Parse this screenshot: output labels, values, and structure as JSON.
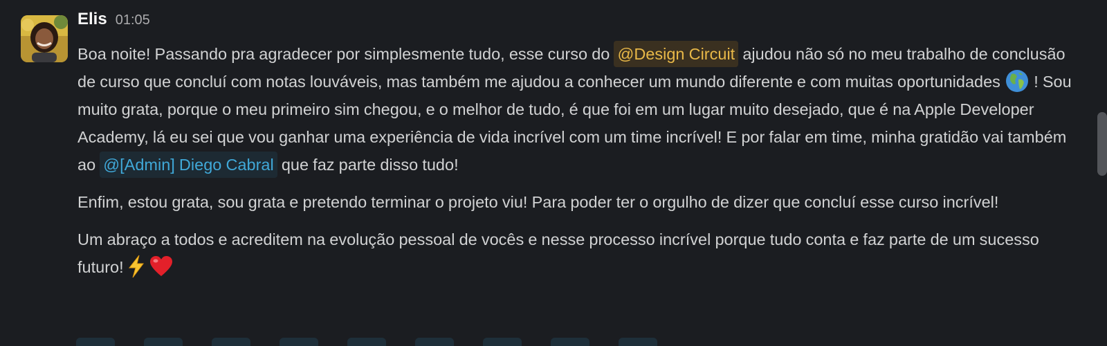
{
  "message": {
    "author": "Elis",
    "time": "01:05",
    "avatar": "avatar-photo",
    "paragraphs": {
      "p1": {
        "t1": "Boa noite! Passando pra agradecer por simplesmente tudo, esse curso do ",
        "mention1": "@Design Circuit",
        "t2": " ajudou não só no meu trabalho de conclusão de curso que concluí com notas louváveis, mas  também me ajudou a conhecer um mundo diferente e com muitas oportunidades ",
        "emoji1": "globe-icon",
        "t3": " ! Sou muito grata, porque o meu primeiro sim chegou, e o melhor de tudo, é que foi em um lugar muito desejado,  que é na Apple Developer Academy, lá eu sei que vou ganhar uma experiência de vida incrível com um time incrível! E por falar em time, minha gratidão vai também ao ",
        "mention2": "@[Admin] Diego Cabral",
        "t4": "  que faz parte disso tudo!"
      },
      "p2": "Enfim, estou grata, sou grata e pretendo terminar o projeto viu! Para poder ter o orgulho de dizer que concluí esse curso incrível!",
      "p3": {
        "t1": "Um abraço a todos e acreditem na evolução pessoal de vocês e nesse processo incrível porque tudo conta e faz parte de um sucesso futuro!",
        "emoji1": "lightning-icon",
        "emoji2": "heart-icon"
      }
    }
  },
  "colors": {
    "background": "#1b1d21",
    "text": "#d1d2d3",
    "mention_user": "#e8b848",
    "mention_admin": "#40a8d8"
  }
}
